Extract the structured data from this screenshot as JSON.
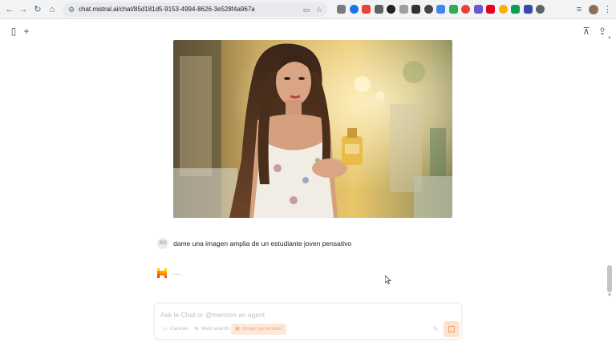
{
  "browser": {
    "url": "chat.mistral.ai/chat/85d181d5-9153-4994-8626-3e528f4a967a",
    "nav": {
      "back_icon": "←",
      "forward_icon": "→",
      "reload_icon": "↻",
      "home_icon": "⌂"
    },
    "extensions": [
      {
        "name": "camera-ext-icon",
        "color": "#7a7a7a"
      },
      {
        "name": "blue-ext-icon",
        "color": "#1a73e8"
      },
      {
        "name": "google-lens-icon",
        "color": "#ea4335"
      },
      {
        "name": "magnifier-ext-icon",
        "color": "#5f6368"
      },
      {
        "name": "notion-ext-icon",
        "color": "#222222"
      },
      {
        "name": "download-ext-icon",
        "color": "#9e9e9e"
      },
      {
        "name": "ea-ext-icon",
        "color": "#333333"
      },
      {
        "name": "json-ext-icon",
        "color": "#444444"
      },
      {
        "name": "translate-ext-icon",
        "color": "#4285f4"
      },
      {
        "name": "sheets-ext-icon",
        "color": "#34a853"
      },
      {
        "name": "redgreen-ext-icon",
        "color": "#e94235"
      },
      {
        "name": "gear-ext-icon",
        "color": "#6a5acd"
      },
      {
        "name": "pinterest-ext-icon",
        "color": "#e60023"
      },
      {
        "name": "speed-ext-icon",
        "color": "#f4b400"
      },
      {
        "name": "sparkle-ext-icon",
        "color": "#0f9d58"
      },
      {
        "name": "purple-ext-icon",
        "color": "#3949ab"
      },
      {
        "name": "puzzle-extensions-icon",
        "color": "#5f6368"
      }
    ]
  },
  "toolbar": {
    "sidebar_icon": "▯",
    "new_chat_icon": "+",
    "pin_icon": "⊼",
    "share_icon": "⇪"
  },
  "messages": {
    "user_avatar": "RO",
    "user_text": "dame una imagen amplia de un estudiante joven pensativo",
    "bot_typing": "..."
  },
  "composer": {
    "placeholder": "Ask le Chat or @mention an agent",
    "tools": [
      {
        "label": "Canvas",
        "icon": "▭"
      },
      {
        "label": "Web search",
        "icon": "⊕"
      },
      {
        "label": "Image generation",
        "icon": "▣"
      }
    ]
  },
  "colors": {
    "accent": "#fa520f",
    "accent_soft": "#fde2d0"
  }
}
